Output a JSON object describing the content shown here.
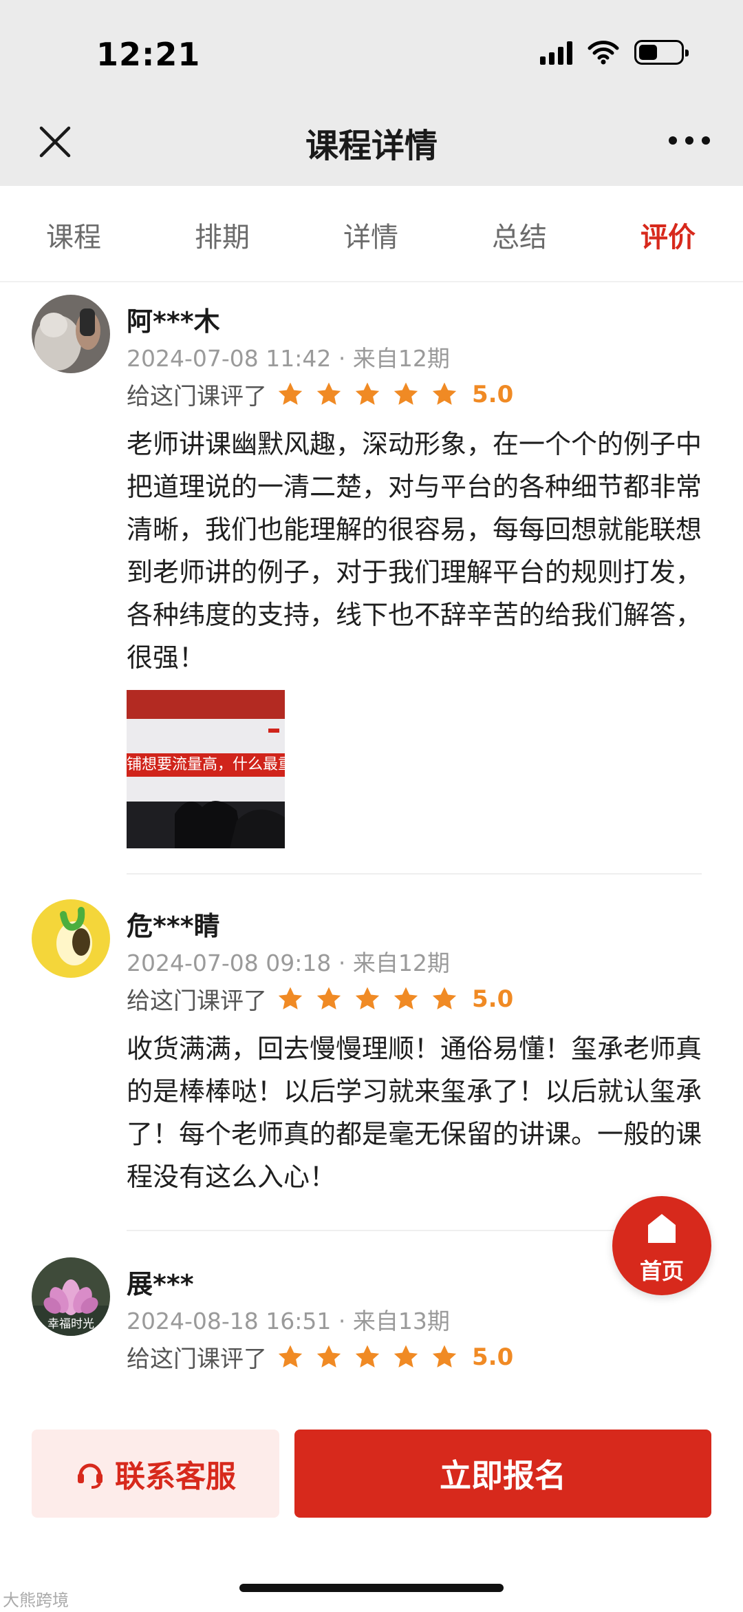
{
  "status_bar": {
    "time": "12:21"
  },
  "nav": {
    "title": "课程详情"
  },
  "tabs": [
    {
      "label": "课程",
      "active": false
    },
    {
      "label": "排期",
      "active": false
    },
    {
      "label": "详情",
      "active": false
    },
    {
      "label": "总结",
      "active": false
    },
    {
      "label": "评价",
      "active": true
    }
  ],
  "reviews": [
    {
      "name": "阿***木",
      "meta": "2024-07-08 11:42 · 来自12期",
      "rate_label": "给这门课评了",
      "stars": 5,
      "score": "5.0",
      "text": "老师讲课幽默风趣，深动形象，在一个个的例子中把道理说的一清二楚，对与平台的各种细节都非常清晰，我们也能理解的很容易，每每回想就能联想到老师讲的例子，对于我们理解平台的规则打发，各种纬度的支持，线下也不辞辛苦的给我们解答，很强！",
      "photo_caption": "铺想要流量高，什么最重"
    },
    {
      "name": "危***睛",
      "meta": "2024-07-08 09:18 · 来自12期",
      "rate_label": "给这门课评了",
      "stars": 5,
      "score": "5.0",
      "text": "收货满满，回去慢慢理顺！通俗易懂！玺承老师真的是棒棒哒！以后学习就来玺承了！以后就认玺承了！每个老师真的都是毫无保留的讲课。一般的课程没有这么入心！"
    },
    {
      "name": "展***",
      "meta": "2024-08-18 16:51 · 来自13期",
      "rate_label": "给这门课评了",
      "stars": 5,
      "score": "5.0",
      "avatar_text": "幸福时光"
    }
  ],
  "fab": {
    "label": "首页"
  },
  "bottom_bar": {
    "contact_label": "联系客服",
    "enroll_label": "立即报名"
  },
  "watermark": "大熊跨境",
  "colors": {
    "accent": "#d7291c",
    "star": "#f08a24",
    "muted": "#9a9a9a"
  }
}
